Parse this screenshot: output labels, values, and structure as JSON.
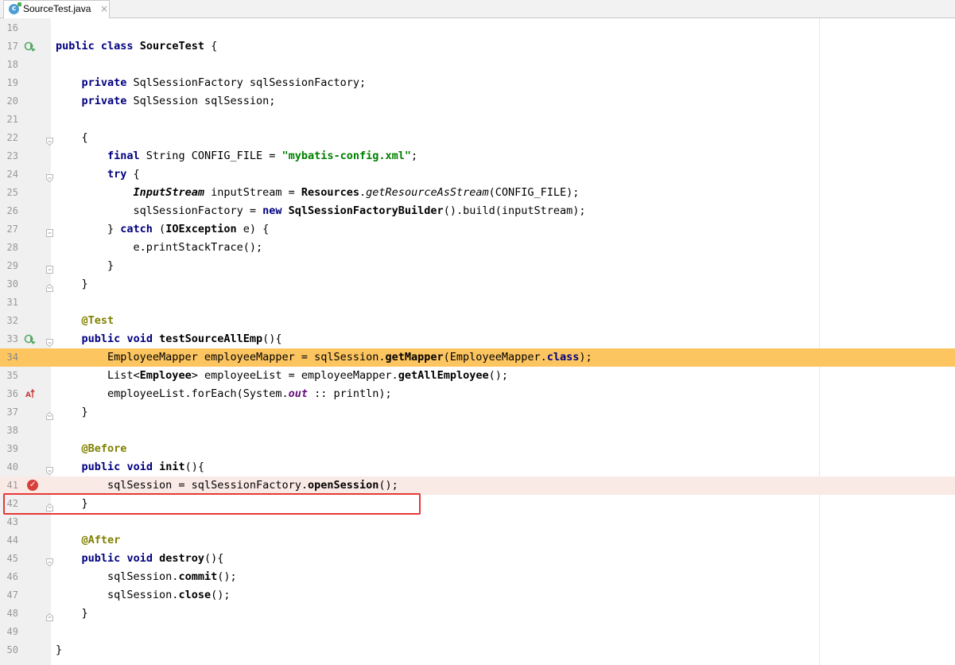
{
  "tab": {
    "file_name": "SourceTest.java",
    "icon_letter": "c",
    "close_glyph": "×"
  },
  "gutter_icons": {
    "run_class": "run-test-class-icon",
    "run_method": "run-test-method-icon",
    "implementing_method": "overriding-method-icon",
    "breakpoint": "breakpoint-icon"
  },
  "colors": {
    "execution_line": "#fdc560",
    "breakpoint_line": "#faeae6",
    "breakpoint": "#d7403a",
    "highlight_box": "#e53935",
    "keyword": "#000080",
    "string": "#008000",
    "annotation": "#808000"
  },
  "lines": [
    {
      "no": "16",
      "text": ""
    },
    {
      "no": "17",
      "text": "public class SourceTest {"
    },
    {
      "no": "18",
      "text": ""
    },
    {
      "no": "19",
      "text": "    private SqlSessionFactory sqlSessionFactory;"
    },
    {
      "no": "20",
      "text": "    private SqlSession sqlSession;"
    },
    {
      "no": "21",
      "text": ""
    },
    {
      "no": "22",
      "text": "    {"
    },
    {
      "no": "23",
      "text": "        final String CONFIG_FILE = \"mybatis-config.xml\";"
    },
    {
      "no": "24",
      "text": "        try {"
    },
    {
      "no": "25",
      "text": "            InputStream inputStream = Resources.getResourceAsStream(CONFIG_FILE);"
    },
    {
      "no": "26",
      "text": "            sqlSessionFactory = new SqlSessionFactoryBuilder().build(inputStream);"
    },
    {
      "no": "27",
      "text": "        } catch (IOException e) {"
    },
    {
      "no": "28",
      "text": "            e.printStackTrace();"
    },
    {
      "no": "29",
      "text": "        }"
    },
    {
      "no": "30",
      "text": "    }"
    },
    {
      "no": "31",
      "text": ""
    },
    {
      "no": "32",
      "text": "    @Test"
    },
    {
      "no": "33",
      "text": "    public void testSourceAllEmp(){"
    },
    {
      "no": "34",
      "text": "        EmployeeMapper employeeMapper = sqlSession.getMapper(EmployeeMapper.class);"
    },
    {
      "no": "35",
      "text": "        List<Employee> employeeList = employeeMapper.getAllEmployee();"
    },
    {
      "no": "36",
      "text": "        employeeList.forEach(System.out :: println);"
    },
    {
      "no": "37",
      "text": "    }"
    },
    {
      "no": "38",
      "text": ""
    },
    {
      "no": "39",
      "text": "    @Before"
    },
    {
      "no": "40",
      "text": "    public void init(){"
    },
    {
      "no": "41",
      "text": "        sqlSession = sqlSessionFactory.openSession();"
    },
    {
      "no": "42",
      "text": "    }"
    },
    {
      "no": "43",
      "text": ""
    },
    {
      "no": "44",
      "text": "    @After"
    },
    {
      "no": "45",
      "text": "    public void destroy(){"
    },
    {
      "no": "46",
      "text": "        sqlSession.commit();"
    },
    {
      "no": "47",
      "text": "        sqlSession.close();"
    },
    {
      "no": "48",
      "text": "    }"
    },
    {
      "no": "49",
      "text": ""
    },
    {
      "no": "50",
      "text": "}"
    }
  ]
}
